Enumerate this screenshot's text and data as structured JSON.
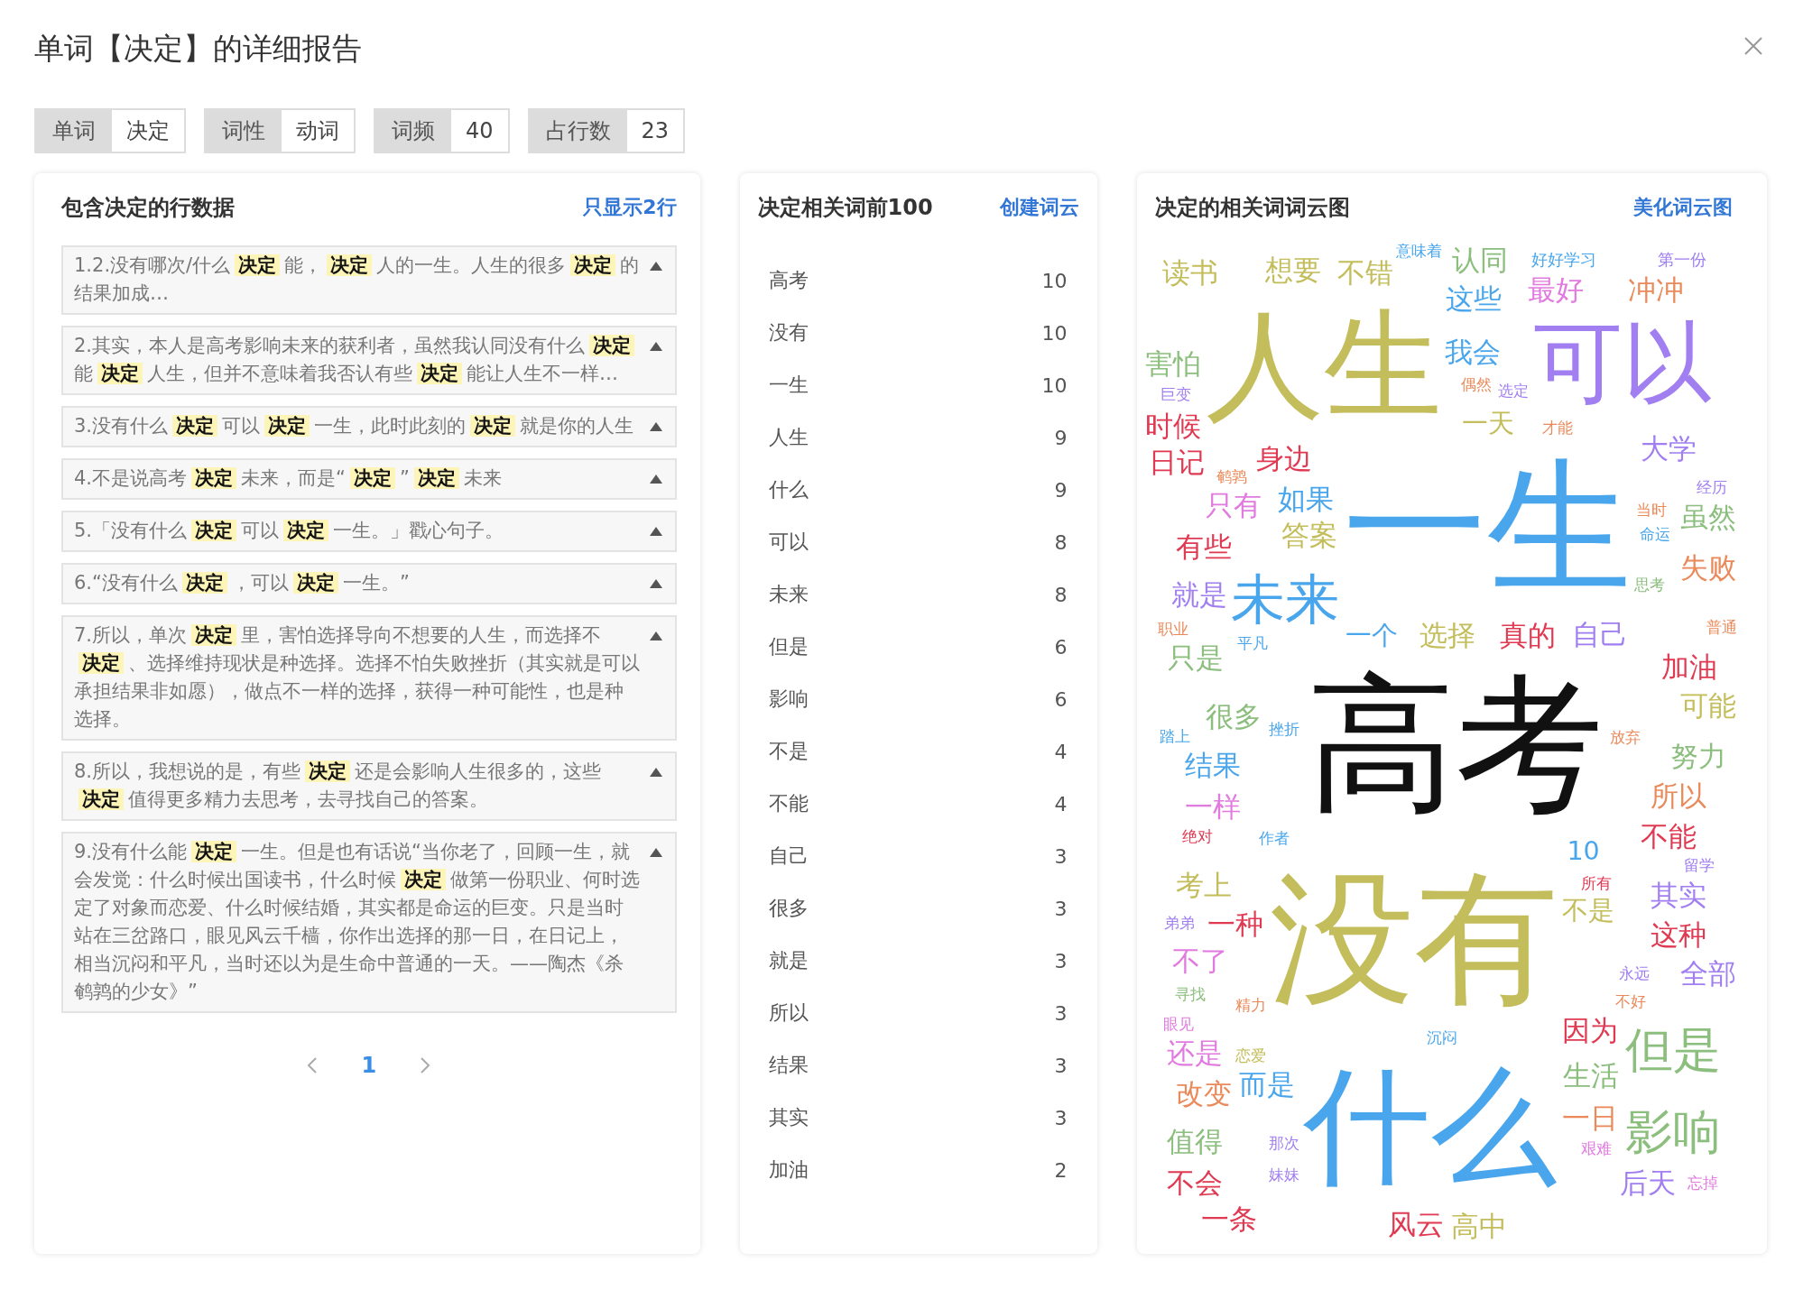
{
  "dialog": {
    "title": "单词【决定】的详细报告"
  },
  "tags": [
    {
      "label": "单词",
      "value": "决定"
    },
    {
      "label": "词性",
      "value": "动词"
    },
    {
      "label": "词频",
      "value": "40"
    },
    {
      "label": "占行数",
      "value": "23"
    }
  ],
  "lines_panel": {
    "title": "包含决定的行数据",
    "action": "只显示2行",
    "rows": [
      {
        "text": "1.2.没有哪次/什么**决定**能，**决定**人的一生。人生的很多**决定**的结果加成…"
      },
      {
        "text": "2.其实，本人是高考影响未来的获利者，虽然我认同没有什么**决定**能**决定**人生，但并不意味着我否认有些**决定**能让人生不一样…"
      },
      {
        "text": "3.没有什么**决定**可以**决定**一生，此时此刻的**决定**就是你的人生"
      },
      {
        "text": "4.不是说高考**决定**未来，而是“**决定**”**决定**未来"
      },
      {
        "text": "5.「没有什么**决定**可以**决定**一生。」戳心句子。"
      },
      {
        "text": "6.“没有什么**决定**，可以**决定**一生。”"
      },
      {
        "text": "7.所以，单次**决定**里，害怕选择导向不想要的人生，而选择不**决定**、选择维持现状是种选择。选择不怕失败挫折（其实就是可以承担结果非如愿），做点不一样的选择，获得一种可能性，也是种选择。"
      },
      {
        "text": "8.所以，我想说的是，有些**决定**还是会影响人生很多的，这些**决定**值得更多精力去思考，去寻找自己的答案。"
      },
      {
        "text": "9.没有什么能**决定**一生。但是也有话说“当你老了，回顾一生，就会发觉：什么时候出国读书，什么时候**决定**做第一份职业、何时选定了对象而恋爱、什么时候结婚，其实都是命运的巨变。只是当时站在三岔路口，眼见风云千樯，你作出选择的那一日，在日记上，相当沉闷和平凡，当时还以为是生命中普通的一天。——陶杰《杀鹌鹑的少女》”"
      }
    ],
    "pagination": {
      "pages": [
        {
          "label": "1",
          "selected": true
        }
      ]
    }
  },
  "related_panel": {
    "title": "决定相关词前100",
    "action": "创建词云",
    "rows": [
      {
        "word": "高考",
        "count": "10"
      },
      {
        "word": "没有",
        "count": "10"
      },
      {
        "word": "一生",
        "count": "10"
      },
      {
        "word": "人生",
        "count": "9"
      },
      {
        "word": "什么",
        "count": "9"
      },
      {
        "word": "可以",
        "count": "8"
      },
      {
        "word": "未来",
        "count": "8"
      },
      {
        "word": "但是",
        "count": "6"
      },
      {
        "word": "影响",
        "count": "6"
      },
      {
        "word": "不是",
        "count": "4"
      },
      {
        "word": "不能",
        "count": "4"
      },
      {
        "word": "自己",
        "count": "3"
      },
      {
        "word": "很多",
        "count": "3"
      },
      {
        "word": "就是",
        "count": "3"
      },
      {
        "word": "所以",
        "count": "3"
      },
      {
        "word": "结果",
        "count": "3"
      },
      {
        "word": "其实",
        "count": "3"
      },
      {
        "word": "加油",
        "count": "2"
      }
    ]
  },
  "cloud_panel": {
    "title": "决定的相关词词云图",
    "action": "美化词云图",
    "words": [
      {
        "text": "人生",
        "color": "#c3bd5b"
      },
      {
        "text": "一生",
        "color": "#4aa6ec"
      },
      {
        "text": "可以",
        "color": "#a17ff0"
      },
      {
        "text": "高考",
        "color": "#111111"
      },
      {
        "text": "没有",
        "color": "#c3bd5b"
      },
      {
        "text": "什么",
        "color": "#4aa6ec"
      },
      {
        "text": "未来",
        "color": "#4aa6ec"
      },
      {
        "text": "但是",
        "color": "#8cbe7e"
      },
      {
        "text": "影响",
        "color": "#8cbe7e"
      },
      {
        "text": "读书",
        "color": "#c3bd5b"
      },
      {
        "text": "想要",
        "color": "#c3bd5b"
      },
      {
        "text": "不错",
        "color": "#c3bd5b"
      },
      {
        "text": "意味着",
        "color": "#4aa6ec"
      },
      {
        "text": "认同",
        "color": "#8cbe7e"
      },
      {
        "text": "好好学习",
        "color": "#4aa6ec"
      },
      {
        "text": "第一份",
        "color": "#a17ff0"
      },
      {
        "text": "害怕",
        "color": "#8cbe7e"
      },
      {
        "text": "这些",
        "color": "#4aa6ec"
      },
      {
        "text": "最好",
        "color": "#e27bdf"
      },
      {
        "text": "冲冲",
        "color": "#ea8a5a"
      },
      {
        "text": "时候",
        "color": "#e03a52"
      },
      {
        "text": "我会",
        "color": "#4aa6ec"
      },
      {
        "text": "偶然",
        "color": "#ea8a5a"
      },
      {
        "text": "选定",
        "color": "#a17ff0"
      },
      {
        "text": "日记",
        "color": "#e03a52"
      },
      {
        "text": "身边",
        "color": "#e03a52"
      },
      {
        "text": "如果",
        "color": "#4aa6ec"
      },
      {
        "text": "巨变",
        "color": "#a17ff0"
      },
      {
        "text": "一天",
        "color": "#c3bd5b"
      },
      {
        "text": "答案",
        "color": "#c3bd5b"
      },
      {
        "text": "鹌鹑",
        "color": "#ea8a5a"
      },
      {
        "text": "大学",
        "color": "#a17ff0"
      },
      {
        "text": "经历",
        "color": "#a17ff0"
      },
      {
        "text": "只有",
        "color": "#e27bdf"
      },
      {
        "text": "当时",
        "color": "#ea8a5a"
      },
      {
        "text": "命运",
        "color": "#4aa6ec"
      },
      {
        "text": "虽然",
        "color": "#8cbe7e"
      },
      {
        "text": "有些",
        "color": "#e03a52"
      },
      {
        "text": "才能",
        "color": "#ea8a5a"
      },
      {
        "text": "失败",
        "color": "#ea8a5a"
      },
      {
        "text": "选择",
        "color": "#c3bd5b"
      },
      {
        "text": "真的",
        "color": "#e03a52"
      },
      {
        "text": "就是",
        "color": "#a17ff0"
      },
      {
        "text": "思考",
        "color": "#8cbe7e"
      },
      {
        "text": "职业",
        "color": "#ea8a5a"
      },
      {
        "text": "平凡",
        "color": "#4aa6ec"
      },
      {
        "text": "自己",
        "color": "#a17ff0"
      },
      {
        "text": "普通",
        "color": "#ea8a5a"
      },
      {
        "text": "只是",
        "color": "#8cbe7e"
      },
      {
        "text": "加油",
        "color": "#e03a52"
      },
      {
        "text": "一个",
        "color": "#4aa6ec"
      },
      {
        "text": "挫折",
        "color": "#4aa6ec"
      },
      {
        "text": "可能",
        "color": "#c3bd5b"
      },
      {
        "text": "很多",
        "color": "#8cbe7e"
      },
      {
        "text": "踏上",
        "color": "#4aa6ec"
      },
      {
        "text": "放弃",
        "color": "#ea8a5a"
      },
      {
        "text": "结果",
        "color": "#4aa6ec"
      },
      {
        "text": "努力",
        "color": "#8cbe7e"
      },
      {
        "text": "一样",
        "color": "#e27bdf"
      },
      {
        "text": "所以",
        "color": "#ea8a5a"
      },
      {
        "text": "绝对",
        "color": "#e03a52"
      },
      {
        "text": "作者",
        "color": "#4aa6ec"
      },
      {
        "text": "不能",
        "color": "#e03a52"
      },
      {
        "text": "10",
        "color": "#4aa6ec"
      },
      {
        "text": "留学",
        "color": "#a17ff0"
      },
      {
        "text": "考上",
        "color": "#c3bd5b"
      },
      {
        "text": "所有",
        "color": "#e03a52"
      },
      {
        "text": "其实",
        "color": "#a17ff0"
      },
      {
        "text": "弟弟",
        "color": "#a17ff0"
      },
      {
        "text": "一种",
        "color": "#e03a52"
      },
      {
        "text": "不是",
        "color": "#c3bd5b"
      },
      {
        "text": "这种",
        "color": "#e03a52"
      },
      {
        "text": "不了",
        "color": "#e27bdf"
      },
      {
        "text": "永远",
        "color": "#a17ff0"
      },
      {
        "text": "全部",
        "color": "#a17ff0"
      },
      {
        "text": "寻找",
        "color": "#8cbe7e"
      },
      {
        "text": "精力",
        "color": "#ea8a5a"
      },
      {
        "text": "而是",
        "color": "#4aa6ec"
      },
      {
        "text": "不好",
        "color": "#ea8a5a"
      },
      {
        "text": "眼见",
        "color": "#e27bdf"
      },
      {
        "text": "沉闷",
        "color": "#4aa6ec"
      },
      {
        "text": "还是",
        "color": "#e27bdf"
      },
      {
        "text": "恋爱",
        "color": "#c3bd5b"
      },
      {
        "text": "因为",
        "color": "#e03a52"
      },
      {
        "text": "生活",
        "color": "#8cbe7e"
      },
      {
        "text": "改变",
        "color": "#ea8a5a"
      },
      {
        "text": "值得",
        "color": "#8cbe7e"
      },
      {
        "text": "那次",
        "color": "#a17ff0"
      },
      {
        "text": "一日",
        "color": "#ea8a5a"
      },
      {
        "text": "艰难",
        "color": "#e27bdf"
      },
      {
        "text": "不会",
        "color": "#e03a52"
      },
      {
        "text": "妹妹",
        "color": "#a17ff0"
      },
      {
        "text": "后天",
        "color": "#a17ff0"
      },
      {
        "text": "忘掉",
        "color": "#e27bdf"
      },
      {
        "text": "一条",
        "color": "#e03a52"
      },
      {
        "text": "风云",
        "color": "#e03a52"
      },
      {
        "text": "高中",
        "color": "#c3bd5b"
      }
    ]
  }
}
